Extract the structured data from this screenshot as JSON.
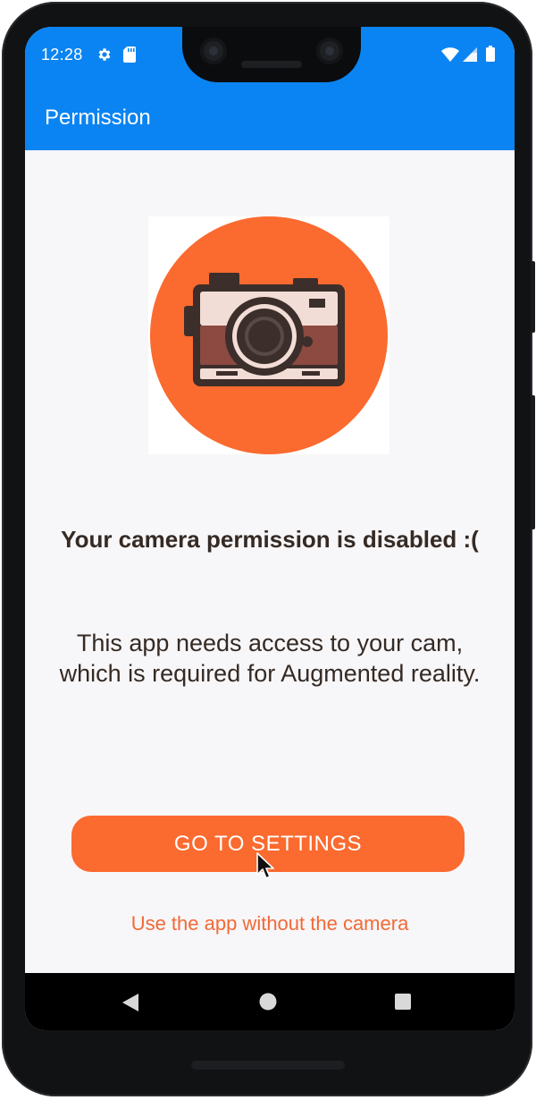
{
  "status_bar": {
    "time": "12:28",
    "icons": [
      "settings-icon",
      "sd-card-icon",
      "wifi-icon",
      "signal-icon",
      "battery-icon"
    ]
  },
  "app_bar": {
    "title": "Permission"
  },
  "illustration": {
    "icon": "camera-icon",
    "circle_color": "#fb6a2f"
  },
  "main": {
    "headline": "Your camera permission is disabled :(",
    "body": "This app needs access to your cam, which is required for Augmented reality.",
    "primary_button": "GO TO SETTINGS",
    "secondary_link": "Use the app without the camera"
  },
  "nav_bar": {
    "buttons": [
      "back-icon",
      "home-icon",
      "recents-icon"
    ]
  },
  "colors": {
    "app_bar": "#0a84f2",
    "accent": "#fb6a2f",
    "link": "#f26a37",
    "text": "#352a24",
    "background": "#f7f6f8"
  }
}
